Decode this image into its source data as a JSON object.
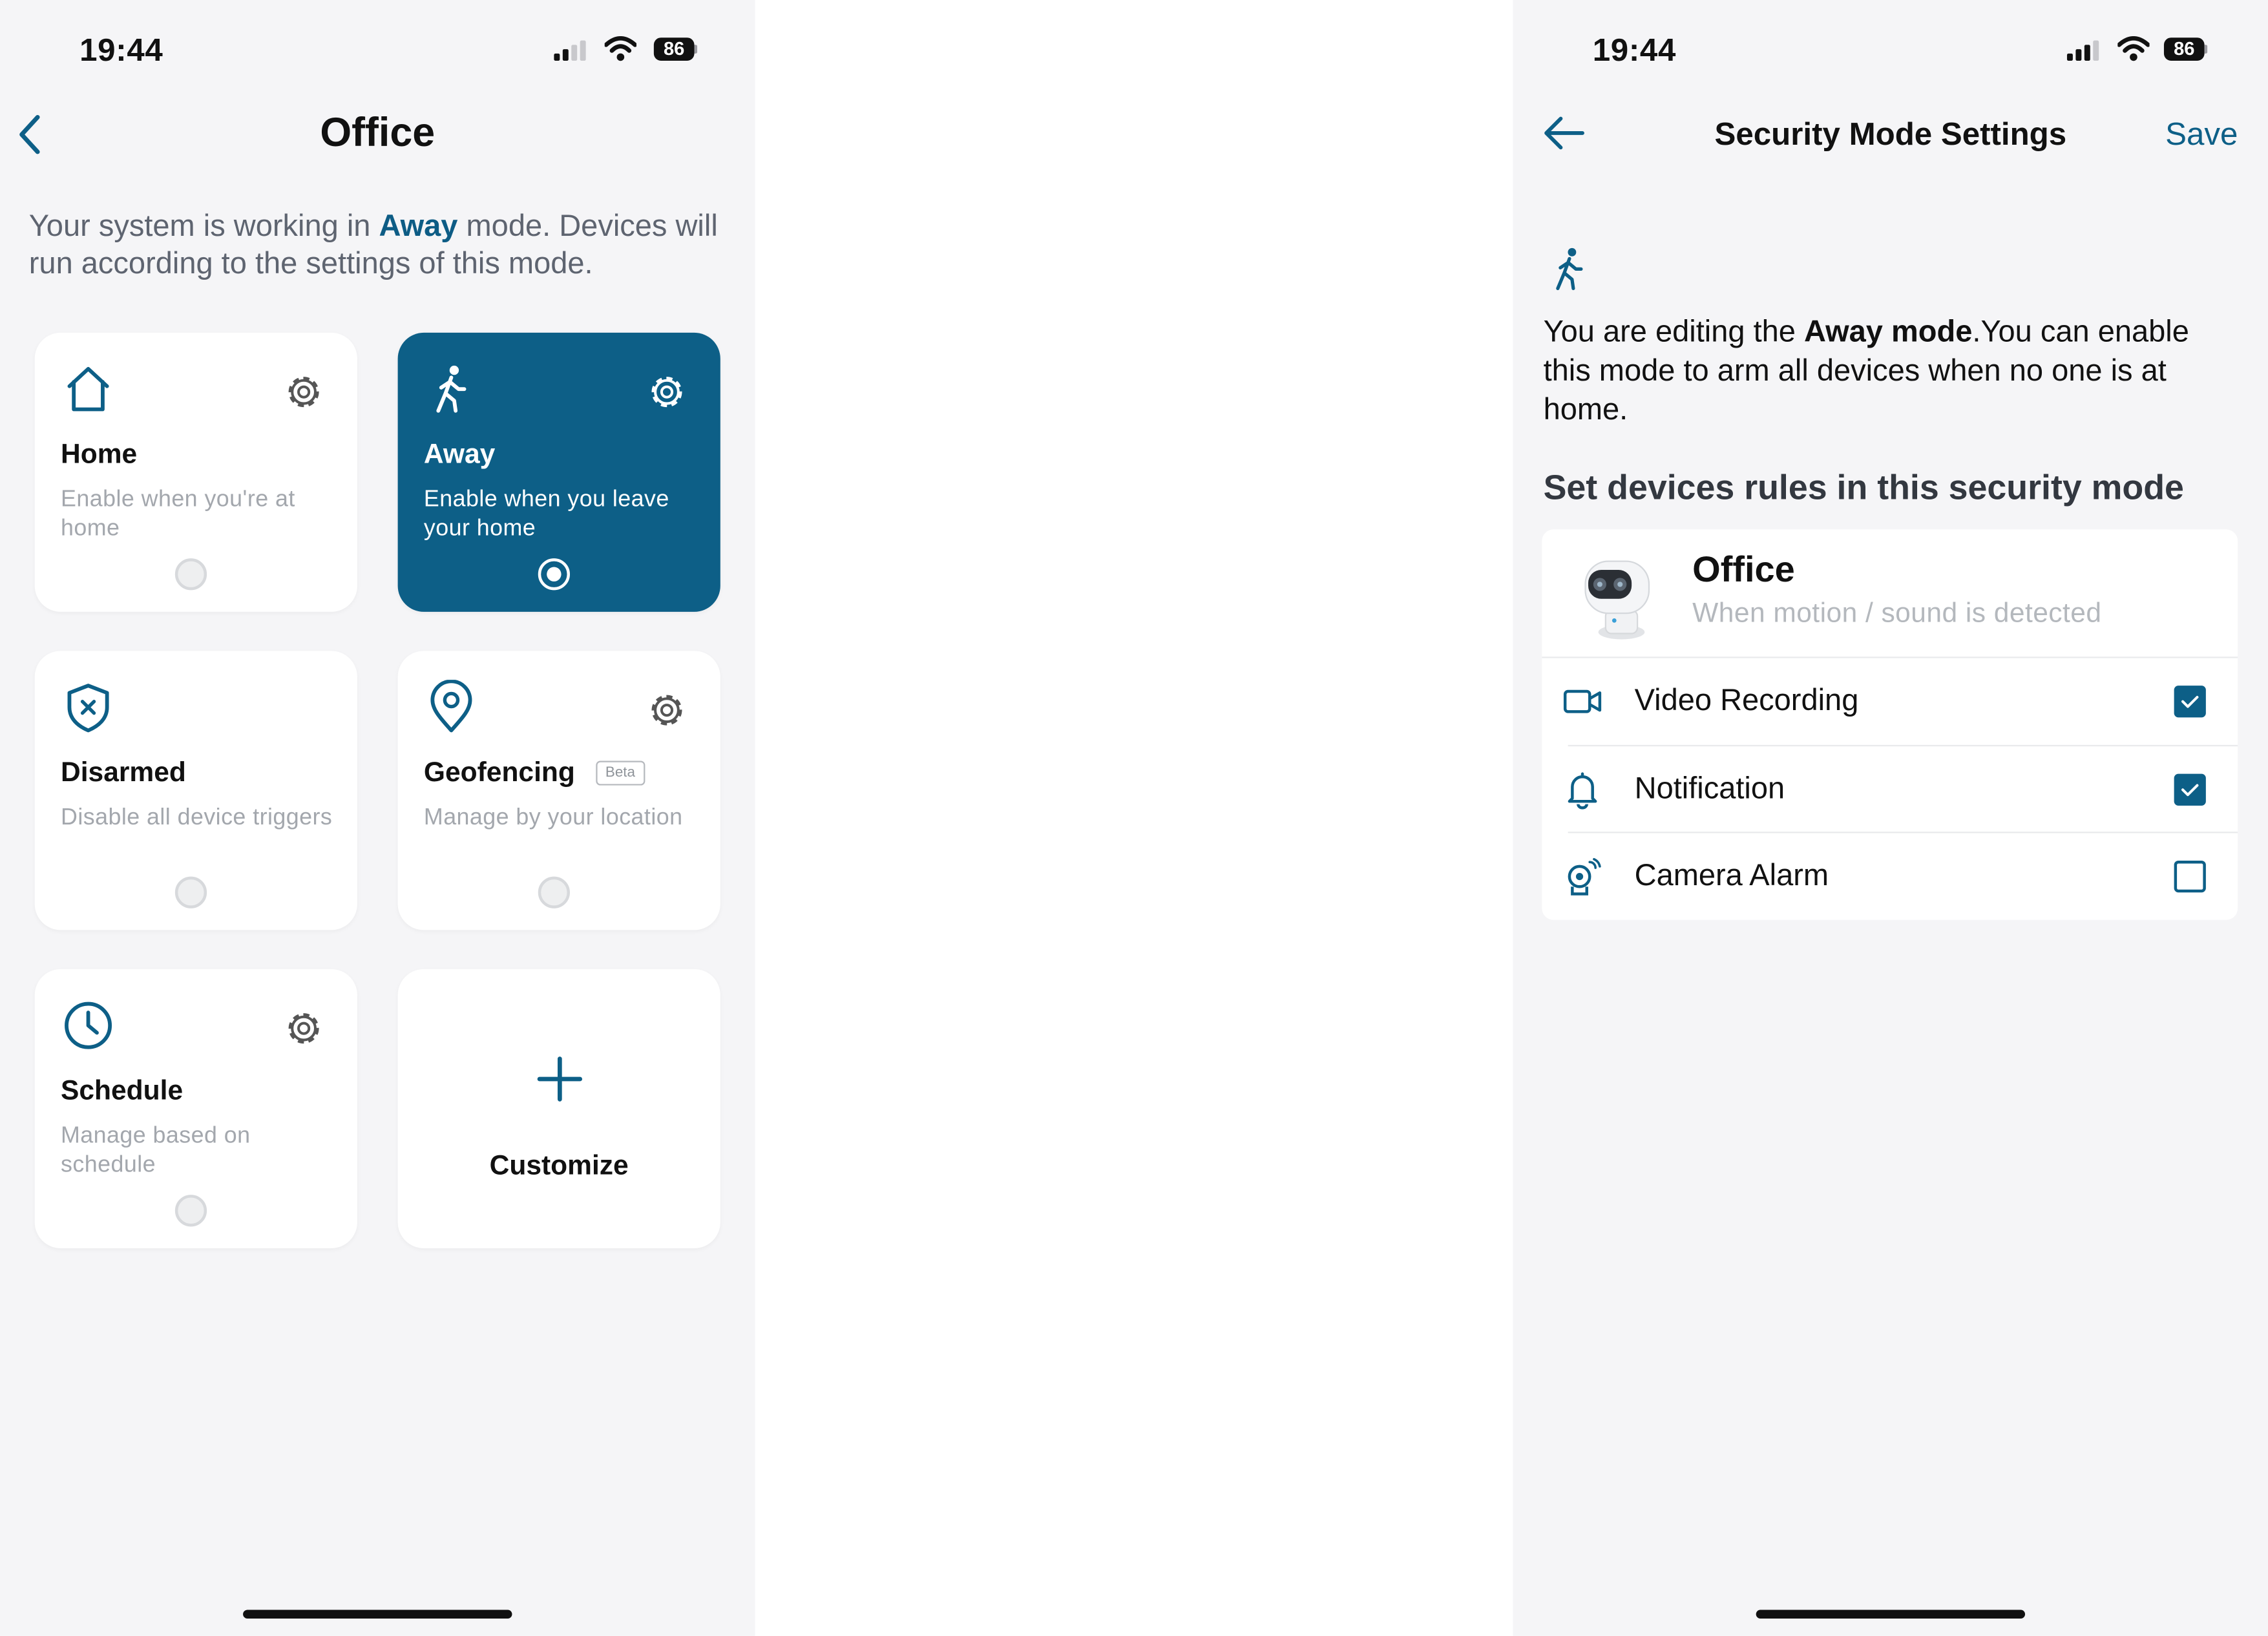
{
  "colors": {
    "accent": "#0d5f87",
    "background": "#f5f5f7",
    "card": "#ffffff",
    "muted_text": "#a3a7ad"
  },
  "left_screen": {
    "status_bar": {
      "time": "19:44",
      "battery": "86"
    },
    "header": {
      "title": "Office",
      "back_icon": "chevron-left-icon"
    },
    "intro": {
      "prefix": "Your system is working in ",
      "mode": "Away",
      "suffix": " mode. Devices will run according to the settings of this mode."
    },
    "modes": [
      {
        "title": "Home",
        "description": "Enable when you're at home",
        "icon": "house-icon",
        "selected": false,
        "has_settings": true
      },
      {
        "title": "Away",
        "description": "Enable when you leave your home",
        "icon": "walking-person-icon",
        "selected": true,
        "has_settings": true
      },
      {
        "title": "Disarmed",
        "description": "Disable all device triggers",
        "icon": "shield-x-icon",
        "selected": false,
        "has_settings": false
      },
      {
        "title": "Geofencing",
        "badge": "Beta",
        "description": "Manage by your location",
        "icon": "location-pin-icon",
        "selected": false,
        "has_settings": true
      },
      {
        "title": "Schedule",
        "description": "Manage based on schedule",
        "icon": "clock-icon",
        "selected": false,
        "has_settings": true
      }
    ],
    "customize": {
      "label": "Customize",
      "icon": "plus-icon"
    }
  },
  "right_screen": {
    "status_bar": {
      "time": "19:44",
      "battery": "86"
    },
    "header": {
      "title": "Security Mode Settings",
      "save_label": "Save",
      "back_icon": "arrow-left-icon"
    },
    "editing": {
      "prefix": "You are editing the ",
      "mode": "Away mode",
      "suffix": ".You can enable this mode to arm all devices when no one is at home."
    },
    "section_title": "Set devices rules in this security mode",
    "device": {
      "name": "Office",
      "subtitle": "When motion / sound is detected",
      "rules": [
        {
          "label": "Video Recording",
          "icon": "video-camera-icon",
          "checked": true
        },
        {
          "label": "Notification",
          "icon": "bell-icon",
          "checked": true
        },
        {
          "label": "Camera Alarm",
          "icon": "camera-alarm-icon",
          "checked": false
        }
      ]
    }
  }
}
